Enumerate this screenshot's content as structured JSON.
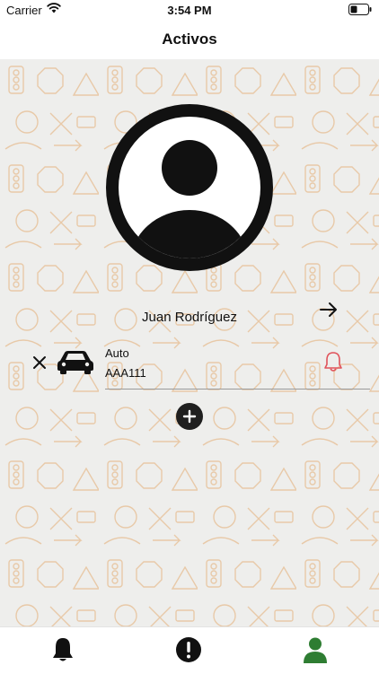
{
  "status_bar": {
    "carrier": "Carrier",
    "time": "3:54 PM",
    "wifi_icon": "wifi-icon",
    "battery_icon": "battery-icon"
  },
  "nav": {
    "title": "Activos"
  },
  "profile": {
    "name": "Juan Rodríguez",
    "avatar_icon": "user-avatar-icon",
    "arrow_icon": "arrow-right-icon"
  },
  "vehicle": {
    "type": "Auto",
    "plate": "AAA111",
    "icon": "car-icon",
    "remove_icon": "close-icon",
    "alert_icon": "bell-icon"
  },
  "add_icon": "plus-icon",
  "tabs": [
    {
      "icon": "bell-icon",
      "active": false
    },
    {
      "icon": "exclamation-icon",
      "active": false
    },
    {
      "icon": "person-icon",
      "active": true
    }
  ],
  "colors": {
    "background": "#eeeeec",
    "pattern": "#e8c9a8",
    "accent_active": "#2e7d32",
    "alert_red": "#e0525a",
    "dark": "#1a1a1a"
  }
}
